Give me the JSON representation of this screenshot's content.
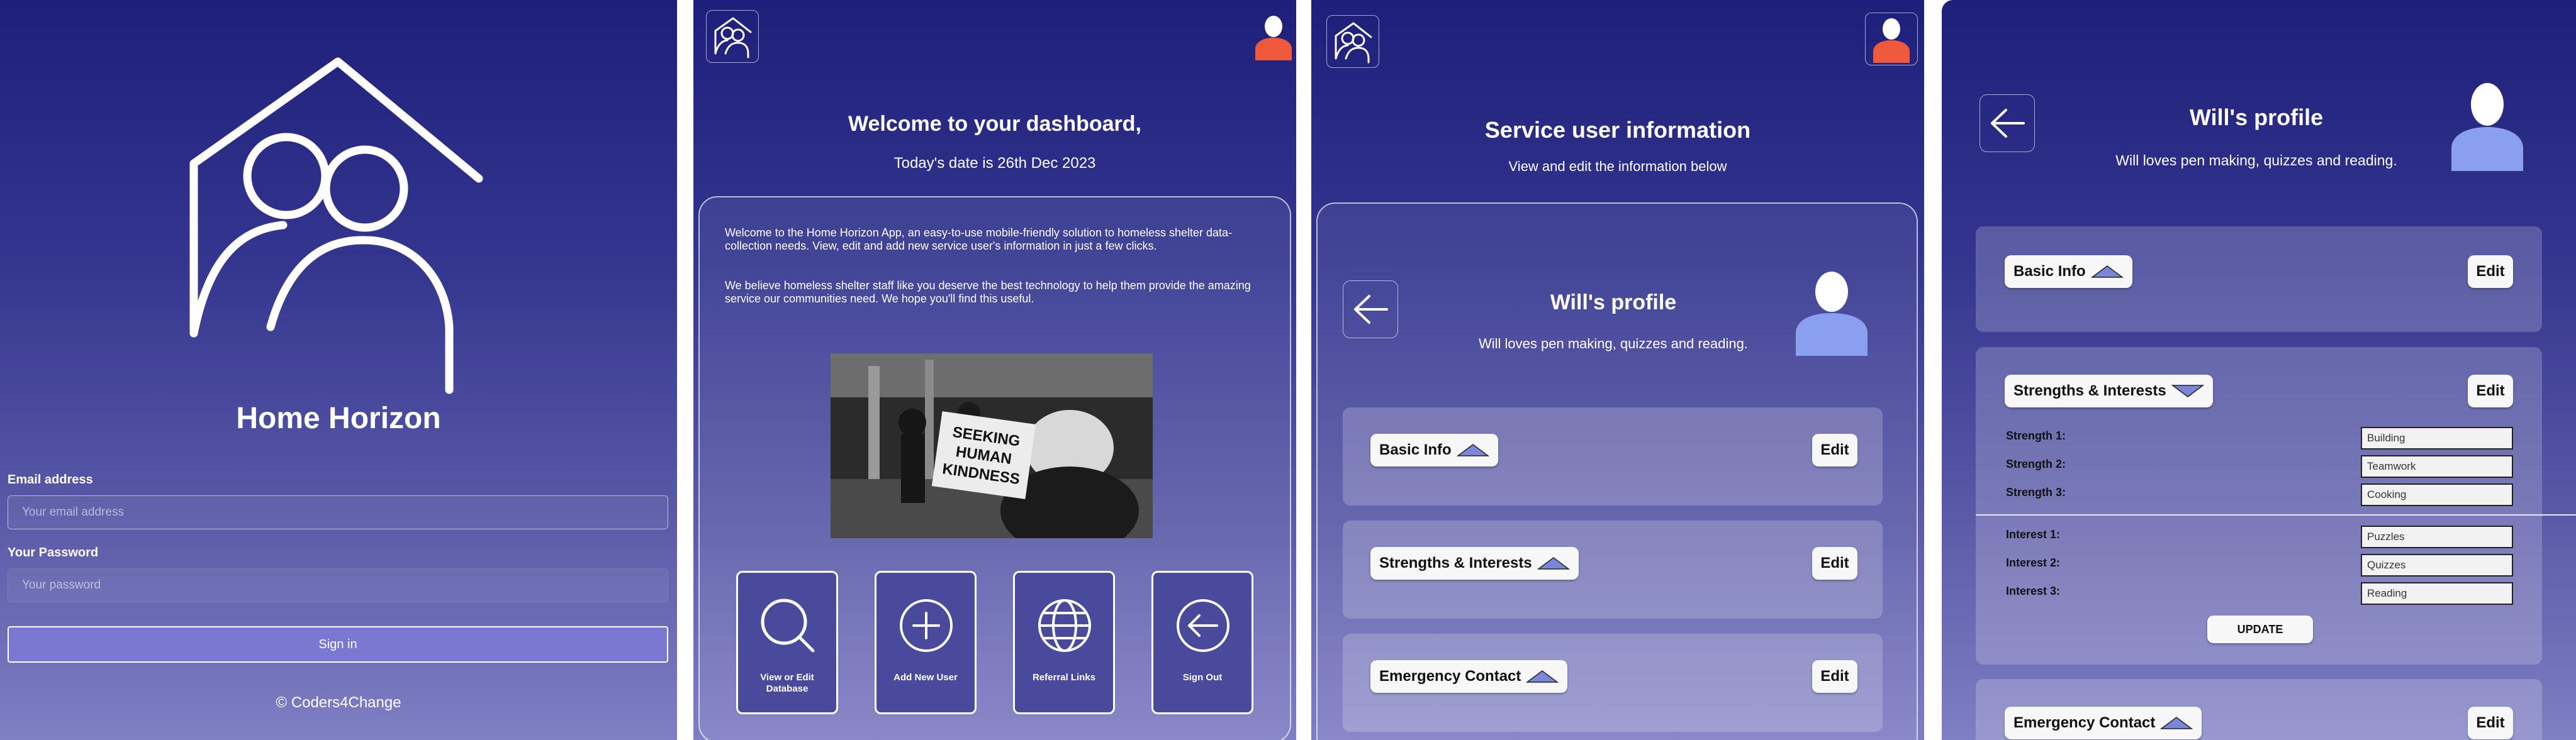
{
  "login": {
    "app_name": "Home Horizon",
    "email_label": "Email address",
    "email_placeholder": "Your email address",
    "password_label": "Your Password",
    "password_placeholder": "Your password",
    "sign_in_label": "Sign in",
    "footer": "© Coders4Change"
  },
  "dashboard": {
    "title": "Welcome to your dashboard,",
    "date_line": "Today's date is 26th Dec 2023",
    "intro_1": "Welcome to the Home Horizon App, an easy-to-use mobile-friendly solution to homeless shelter data-collection needs. View, edit and add new service user's information in just a few clicks.",
    "intro_2": "We believe homeless shelter staff like you deserve the best technology to help them provide the amazing service our communities need. We hope you'll find this useful.",
    "sign_text": "SEEKING HUMAN KINDNESS",
    "tiles": [
      {
        "label": "View or Edit Database",
        "icon": "search-icon"
      },
      {
        "label": "Add New User",
        "icon": "plus-circle-icon"
      },
      {
        "label": "Referral Links",
        "icon": "globe-icon"
      },
      {
        "label": "Sign Out",
        "icon": "arrow-left-circle-icon"
      }
    ]
  },
  "service_info": {
    "title": "Service user information",
    "subtitle": "View and edit the information below"
  },
  "profile": {
    "title": "Will's profile",
    "subtitle": "Will loves pen making, quizzes and reading.",
    "edit_label": "Edit",
    "sections": {
      "basic": "Basic Info",
      "strengths": "Strengths & Interests",
      "emergency": "Emergency Contact"
    },
    "strengths": [
      {
        "label": "Strength 1:",
        "value": "Building"
      },
      {
        "label": "Strength 2:",
        "value": "Teamwork"
      },
      {
        "label": "Strength 3:",
        "value": "Cooking"
      }
    ],
    "interests": [
      {
        "label": "Interest 1:",
        "value": "Puzzles"
      },
      {
        "label": "Interest 2:",
        "value": "Quizzes"
      },
      {
        "label": "Interest 3:",
        "value": "Reading"
      }
    ],
    "update_label": "UPDATE"
  },
  "colors": {
    "gradient_top": "#1e1f7a",
    "gradient_bottom": "#7f7fc4",
    "avatar_red": "#f05a3c",
    "avatar_blue": "#8a9ff0",
    "arrow_blue": "#7a86d8",
    "sign_in_bg": "#7a78d0"
  }
}
